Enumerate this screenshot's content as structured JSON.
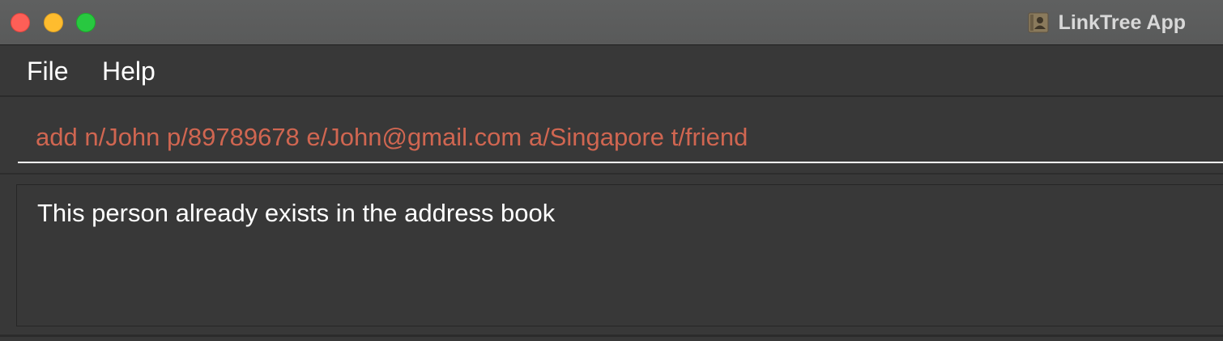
{
  "window": {
    "title": "LinkTree App",
    "app_icon": "contacts-book-icon",
    "controls": [
      "close-icon",
      "minimize-icon",
      "maximize-icon"
    ]
  },
  "menu": {
    "file_label": "File",
    "help_label": "Help"
  },
  "command_box": {
    "value": "add n/John p/89789678 e/John@gmail.com a/Singapore t/friend"
  },
  "result_display": {
    "message": "This person already exists in the address book"
  },
  "colors": {
    "background": "#383838",
    "command_text": "#d06651",
    "result_text": "#ffffff",
    "close": "#fe5f57",
    "minimize": "#febc2e",
    "maximize": "#28c840"
  }
}
